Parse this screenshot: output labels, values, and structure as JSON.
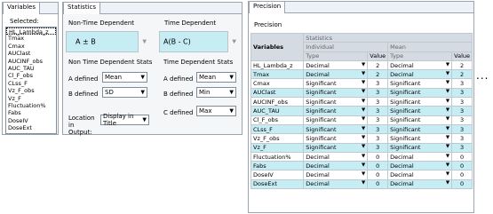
{
  "variables_panel": {
    "tab": "Variables",
    "selected_label": "Selected:",
    "items": [
      "HL_Lambda_z",
      "Tmax",
      "Cmax",
      "AUClast",
      "AUCINF_obs",
      "AUC_TAU",
      "Cl_F_obs",
      "CLss_F",
      "Vz_F_obs",
      "Vz_F",
      "Fluctuation%",
      "Fabs",
      "DoseIV",
      "DoseExt"
    ]
  },
  "statistics_panel": {
    "tab": "Statistics",
    "non_time_dependent_label": "Non-Time Dependent",
    "time_dependent_label": "Time Dependent",
    "non_time_value": "A ± B",
    "time_value": "A(B - C)",
    "non_time_stats_title": "Non Time Dependent Stats",
    "time_stats_title": "Time Dependent Stats",
    "a_defined_label": "A defined",
    "b_defined_label": "B defined",
    "c_defined_label": "C defined",
    "nt_a_value": "Mean",
    "nt_b_value": "SD",
    "t_a_value": "Mean",
    "t_b_value": "Min",
    "t_c_value": "Max",
    "location_label": "Location in Output:",
    "location_value": "Display in Title"
  },
  "precision_panel": {
    "tab": "Precision",
    "sub_label": "Precision",
    "headers": {
      "variables": "Variables",
      "statistics": "Statistics",
      "individual": "Individual",
      "mean": "Mean",
      "type": "Type",
      "value": "Value"
    },
    "rows": [
      {
        "name": "HL_Lambda_z",
        "ind_type": "Decimal",
        "ind_value": "2",
        "mean_type": "Decimal",
        "mean_value": "2"
      },
      {
        "name": "Tmax",
        "ind_type": "Decimal",
        "ind_value": "2",
        "mean_type": "Decimal",
        "mean_value": "2"
      },
      {
        "name": "Cmax",
        "ind_type": "Significant",
        "ind_value": "3",
        "mean_type": "Significant",
        "mean_value": "3"
      },
      {
        "name": "AUClast",
        "ind_type": "Significant",
        "ind_value": "3",
        "mean_type": "Significant",
        "mean_value": "3"
      },
      {
        "name": "AUCINF_obs",
        "ind_type": "Significant",
        "ind_value": "3",
        "mean_type": "Significant",
        "mean_value": "3"
      },
      {
        "name": "AUC_TAU",
        "ind_type": "Significant",
        "ind_value": "3",
        "mean_type": "Significant",
        "mean_value": "3"
      },
      {
        "name": "Cl_F_obs",
        "ind_type": "Significant",
        "ind_value": "3",
        "mean_type": "Significant",
        "mean_value": "3"
      },
      {
        "name": "CLss_F",
        "ind_type": "Significant",
        "ind_value": "3",
        "mean_type": "Significant",
        "mean_value": "3"
      },
      {
        "name": "Vz_F_obs",
        "ind_type": "Significant",
        "ind_value": "3",
        "mean_type": "Significant",
        "mean_value": "3"
      },
      {
        "name": "Vz_F",
        "ind_type": "Significant",
        "ind_value": "3",
        "mean_type": "Significant",
        "mean_value": "3"
      },
      {
        "name": "Fluctuation%",
        "ind_type": "Decimal",
        "ind_value": "0",
        "mean_type": "Decimal",
        "mean_value": "0"
      },
      {
        "name": "Fabs",
        "ind_type": "Decimal",
        "ind_value": "0",
        "mean_type": "Decimal",
        "mean_value": "0"
      },
      {
        "name": "DoseIV",
        "ind_type": "Decimal",
        "ind_value": "0",
        "mean_type": "Decimal",
        "mean_value": "0"
      },
      {
        "name": "DoseExt",
        "ind_type": "Decimal",
        "ind_value": "0",
        "mean_type": "Decimal",
        "mean_value": "0"
      }
    ],
    "row_colors": {
      "teal": "#c6ecf4",
      "white": "#ffffff"
    }
  },
  "more_indicator": "..."
}
